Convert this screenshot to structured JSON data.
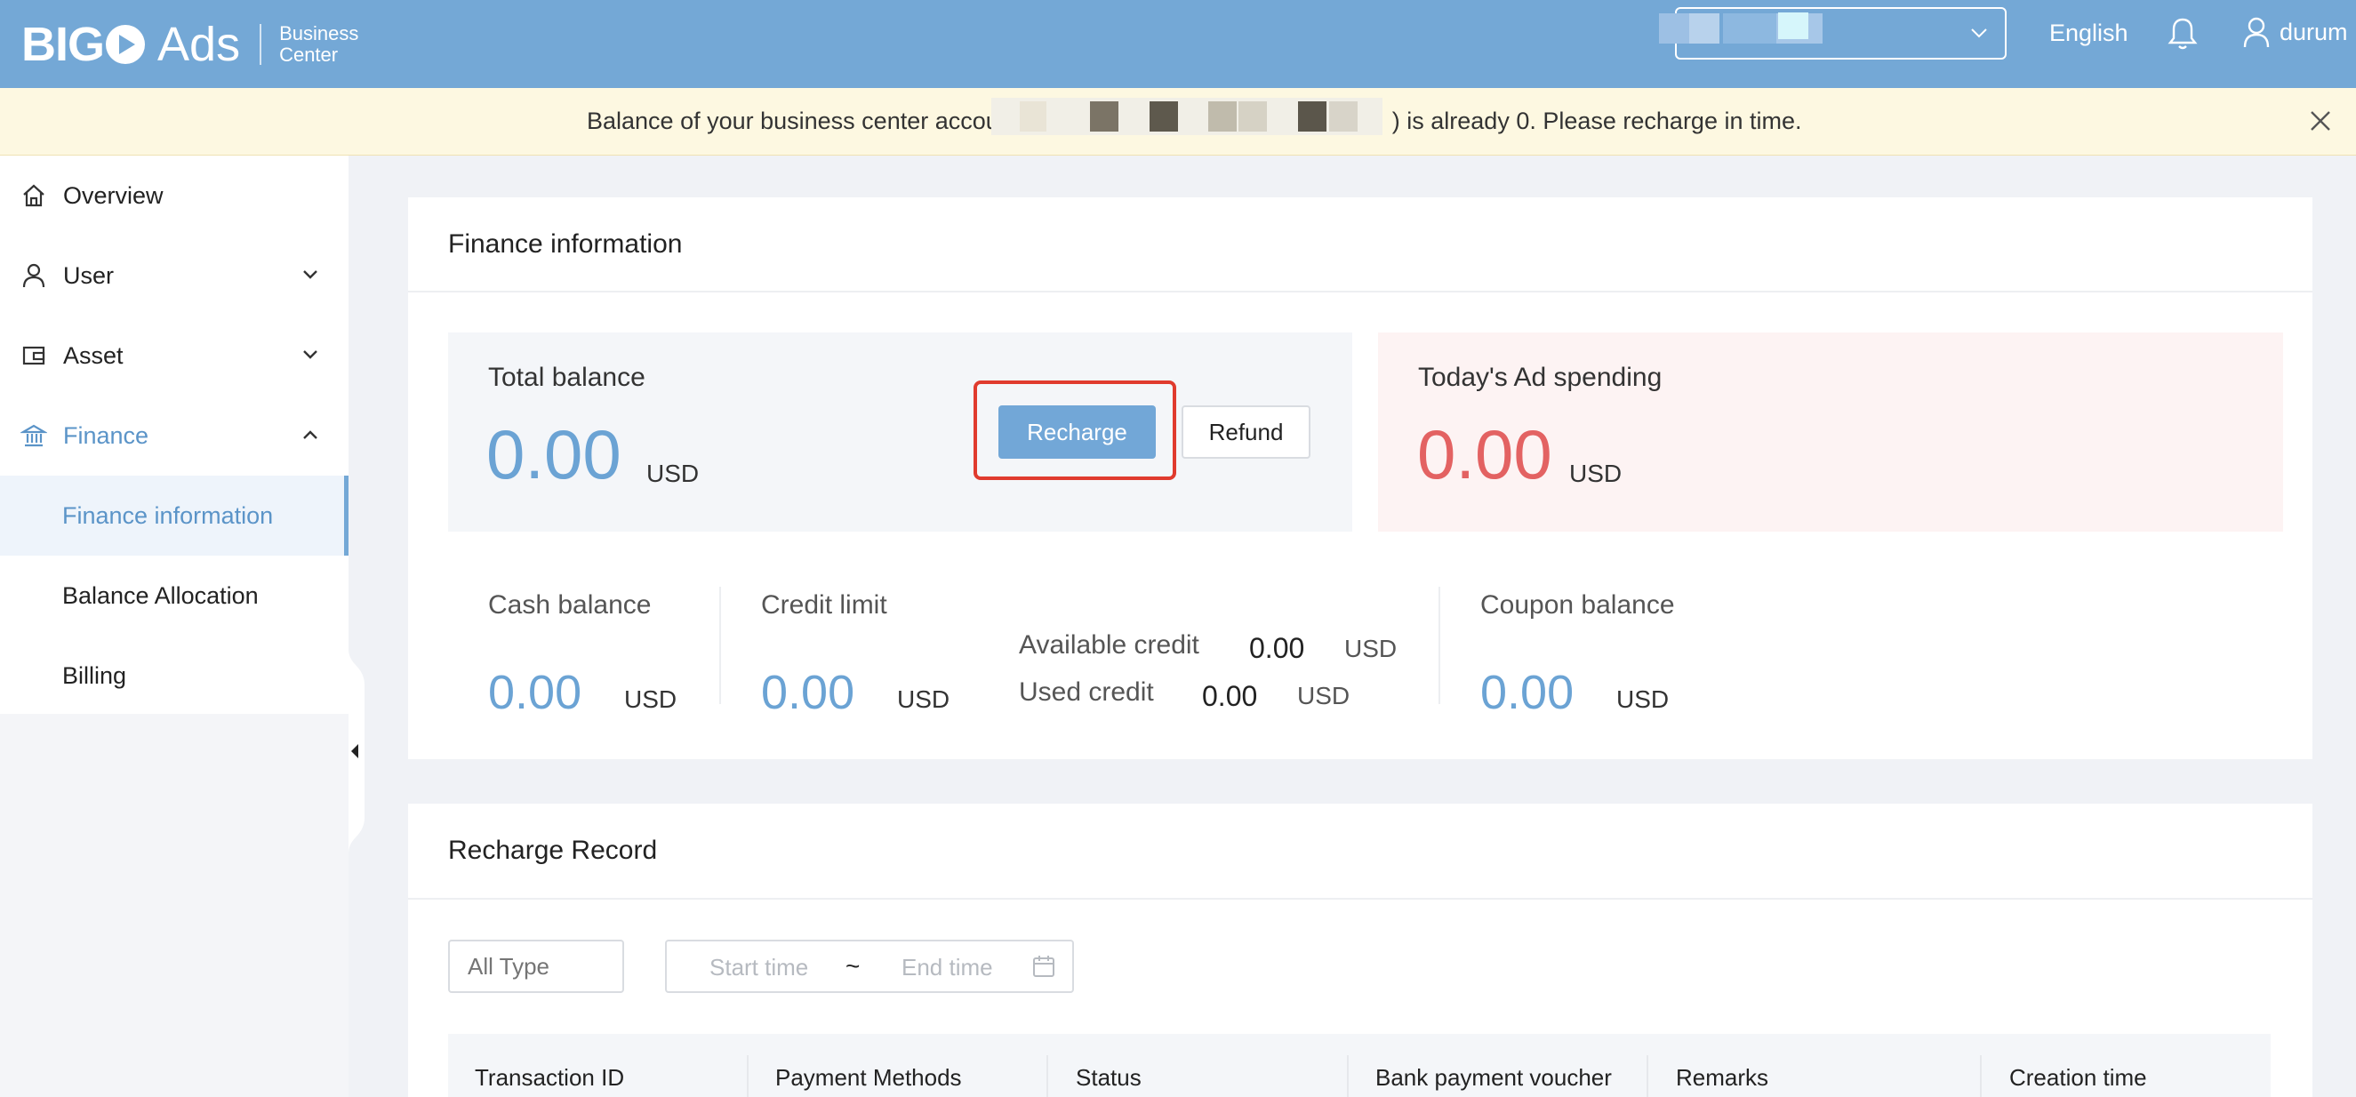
{
  "header": {
    "brand_main": "BIGO",
    "brand_ads": "Ads",
    "brand_sub_1": "Business",
    "brand_sub_2": "Center",
    "language": "English",
    "username": "durum"
  },
  "notice": {
    "prefix": "Balance of your business center accou",
    "suffix": ") is already 0. Please recharge in time."
  },
  "sidebar": {
    "overview": "Overview",
    "user": "User",
    "asset": "Asset",
    "finance": "Finance",
    "finance_information": "Finance information",
    "balance_allocation": "Balance Allocation",
    "billing": "Billing"
  },
  "finance": {
    "title": "Finance information",
    "total_balance_label": "Total balance",
    "total_balance_value": "0.00",
    "total_balance_unit": "USD",
    "recharge_label": "Recharge",
    "refund_label": "Refund",
    "spending_label": "Today's Ad spending",
    "spending_value": "0.00",
    "spending_unit": "USD",
    "cash_label": "Cash balance",
    "cash_value": "0.00",
    "cash_unit": "USD",
    "credit_label": "Credit limit",
    "credit_value": "0.00",
    "credit_unit": "USD",
    "available_label": "Available credit",
    "available_value": "0.00",
    "available_unit": "USD",
    "used_label": "Used credit",
    "used_value": "0.00",
    "used_unit": "USD",
    "coupon_label": "Coupon balance",
    "coupon_value": "0.00",
    "coupon_unit": "USD"
  },
  "recharge_record": {
    "title": "Recharge Record",
    "type_placeholder": "All Type",
    "start_placeholder": "Start time",
    "tilde": "~",
    "end_placeholder": "End time",
    "columns": [
      "Transaction ID",
      "Payment Methods",
      "Status",
      "Bank payment voucher",
      "Remarks",
      "Creation time"
    ]
  },
  "colors": {
    "header_bg": "#74a8d6",
    "accent_blue": "#6ba3d4",
    "spending_red": "#e36262",
    "highlight_red": "#e03b2e",
    "notice_bg": "#fdf8e1"
  }
}
